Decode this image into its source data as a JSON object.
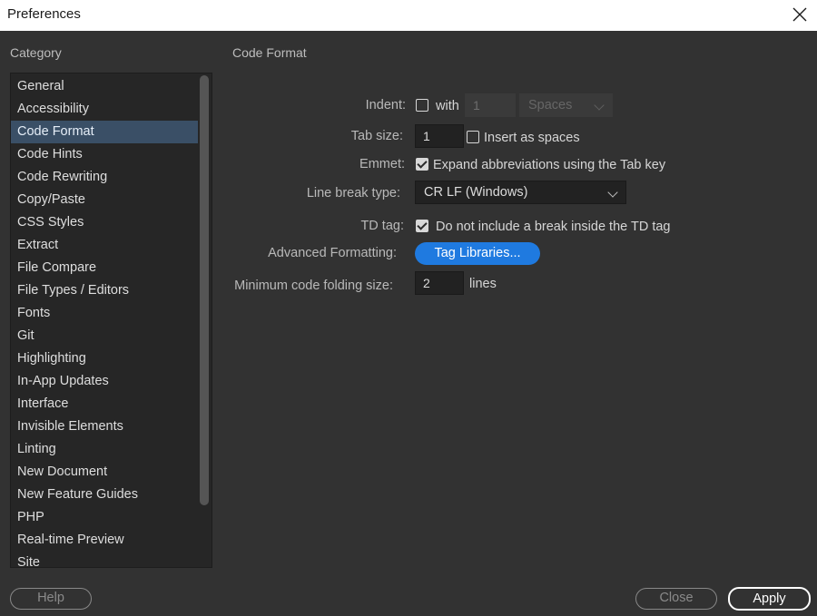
{
  "window": {
    "title": "Preferences"
  },
  "category": {
    "label": "Category",
    "items": [
      "General",
      "Accessibility",
      "Code Format",
      "Code Hints",
      "Code Rewriting",
      "Copy/Paste",
      "CSS Styles",
      "Extract",
      "File Compare",
      "File Types / Editors",
      "Fonts",
      "Git",
      "Highlighting",
      "In-App Updates",
      "Interface",
      "Invisible Elements",
      "Linting",
      "New Document",
      "New Feature Guides",
      "PHP",
      "Real-time Preview",
      "Site"
    ],
    "selected": "Code Format"
  },
  "panel": {
    "title": "Code Format",
    "indent": {
      "label": "Indent:",
      "checked": false,
      "with_label": "with",
      "value": "1",
      "unit": "Spaces"
    },
    "tab_size": {
      "label": "Tab size:",
      "value": "1",
      "insert_spaces_label": "Insert as spaces",
      "insert_spaces_checked": false
    },
    "emmet": {
      "label": "Emmet:",
      "checked": true,
      "text": "Expand abbreviations using the Tab key"
    },
    "line_break": {
      "label": "Line break type:",
      "value": "CR LF (Windows)"
    },
    "td_tag": {
      "label": "TD tag:",
      "checked": true,
      "text": "Do not include a break inside the TD tag"
    },
    "advanced": {
      "label": "Advanced Formatting:",
      "button": "Tag Libraries..."
    },
    "folding": {
      "label": "Minimum code folding size:",
      "value": "2",
      "unit": "lines"
    }
  },
  "footer": {
    "help": "Help",
    "close": "Close",
    "apply": "Apply"
  },
  "colors": {
    "background": "#323232",
    "selection": "#3a4f66",
    "accent": "#1f7ae0"
  }
}
